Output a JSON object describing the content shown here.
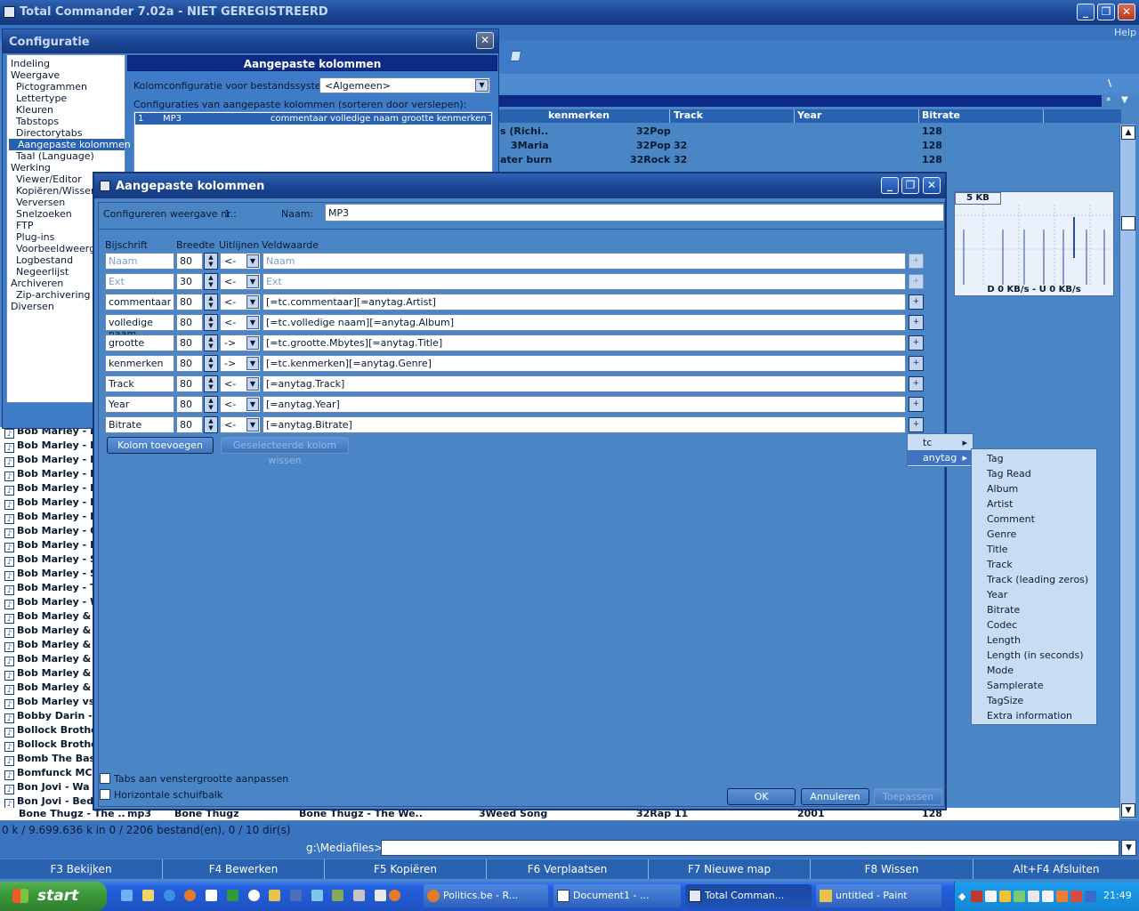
{
  "app": {
    "title": "Total Commander 7.02a - NIET GEREGISTREERD",
    "help": "Help",
    "path_backslash": "\\",
    "path_star": "*",
    "right_columns": [
      "kenmerken",
      "Track",
      "Year",
      "Bitrate"
    ],
    "right_rows": [
      {
        "c1": "s (Richi..",
        "c2": "32Pop",
        "c3": "",
        "c4": "128"
      },
      {
        "c1": "3Maria",
        "c2": "32Pop",
        "c3": "32",
        "c4": "128"
      },
      {
        "c1": "ater burn",
        "c2": "32Rock",
        "c3": "32",
        "c4": "128"
      }
    ],
    "speed_size": "5 KB",
    "speed_text": "D 0 KB/s - U 0 KB/s",
    "left_rows": [
      "Bob Marley - B",
      "Bob Marley - E",
      "Bob Marley - I",
      "Bob Marley - K",
      "Bob Marley - K",
      "Bob Marley - M",
      "Bob Marley - M",
      "Bob Marley - O",
      "Bob Marley - R",
      "Bob Marley - S",
      "Bob Marley - S",
      "Bob Marley - T",
      "Bob Marley - W",
      "Bob Marley & F",
      "Bob Marley & F",
      "Bob Marley & F",
      "Bob Marley & F",
      "Bob Marley & F",
      "Bob Marley & S",
      "Bob Marley vs",
      "Bobby Darin -",
      "Bollock Brothe",
      "Bollock Brothe",
      "Bomb The Bas",
      "Bomfunck MC'",
      "Bon Jovi - Wa",
      "Bon Jovi - Bed"
    ],
    "bottom_row": {
      "name": "Bone Thugz - The ..",
      "ext": "mp3",
      "artist": "Bone Thugz",
      "title": "Bone Thugz - The We..",
      "track": "3Weed Song",
      "genre": "32Rap 11",
      "year": "2001",
      "bitrate": "128"
    },
    "status": "0 k / 9.699.636 k in 0 / 2206 bestand(en), 0 / 10 dir(s)",
    "cmd_path": "g:\\Mediafiles>",
    "fkeys": [
      "F3 Bekijken",
      "F4 Bewerken",
      "F5 Kopiëren",
      "F6 Verplaatsen",
      "F7 Nieuwe map",
      "F8 Wissen",
      "Alt+F4 Afsluiten"
    ]
  },
  "config": {
    "title": "Configuratie",
    "tree": [
      {
        "label": "Indeling",
        "level": 0
      },
      {
        "label": "Weergave",
        "level": 0
      },
      {
        "label": "Pictogrammen",
        "level": 1
      },
      {
        "label": "Lettertype",
        "level": 1
      },
      {
        "label": "Kleuren",
        "level": 1
      },
      {
        "label": "Tabstops",
        "level": 1
      },
      {
        "label": "Directorytabs",
        "level": 1
      },
      {
        "label": "Aangepaste kolommen",
        "level": 1,
        "selected": true
      },
      {
        "label": "Taal (Language)",
        "level": 1
      },
      {
        "label": "Werking",
        "level": 0
      },
      {
        "label": "Viewer/Editor",
        "level": 1
      },
      {
        "label": "Kopiëren/Wissen",
        "level": 1
      },
      {
        "label": "Verversen",
        "level": 1
      },
      {
        "label": "Snelzoeken",
        "level": 1
      },
      {
        "label": "FTP",
        "level": 1
      },
      {
        "label": "Plug-ins",
        "level": 1
      },
      {
        "label": "Voorbeeldweergave",
        "level": 1
      },
      {
        "label": "Logbestand",
        "level": 1
      },
      {
        "label": "Negeerlijst",
        "level": 1
      },
      {
        "label": "Archiveren",
        "level": 0
      },
      {
        "label": "Zip-archivering",
        "level": 1
      },
      {
        "label": "Diversen",
        "level": 0
      }
    ],
    "section_title": "Aangepaste kolommen",
    "fs_label": "Kolomconfiguratie voor bestandssysteem:",
    "fs_value": "<Algemeen>",
    "list_label": "Configuraties van aangepaste kolommen (sorteren door verslepen):",
    "list_item": {
      "num": "1",
      "name": "MP3",
      "cols": "commentaar  volledige naam  grootte  kenmerken  T"
    }
  },
  "dialog": {
    "title": "Aangepaste kolommen",
    "config_label": "Configureren weergave nr.:",
    "config_nr": "1",
    "name_label": "Naam:",
    "name_value": "MP3",
    "headers": {
      "caption": "Bijschrift",
      "width": "Breedte",
      "align": "Uitlijnen",
      "field": "Veldwaarde"
    },
    "rows": [
      {
        "caption": "Naam",
        "width": "80",
        "align": "<-",
        "field": "Naam",
        "disabled": true
      },
      {
        "caption": "Ext",
        "width": "30",
        "align": "<-",
        "field": "Ext",
        "disabled": true
      },
      {
        "caption": "commentaar",
        "width": "80",
        "align": "<-",
        "field": "[=tc.commentaar][=anytag.Artist]"
      },
      {
        "caption": "volledige naam",
        "width": "80",
        "align": "<-",
        "field": "[=tc.volledige naam][=anytag.Album]"
      },
      {
        "caption": "grootte",
        "width": "80",
        "align": "->",
        "field": "[=tc.grootte.Mbytes][=anytag.Title]"
      },
      {
        "caption": "kenmerken",
        "width": "80",
        "align": "->",
        "field": "[=tc.kenmerken][=anytag.Genre]"
      },
      {
        "caption": "Track",
        "width": "80",
        "align": "<-",
        "field": "[=anytag.Track]"
      },
      {
        "caption": "Year",
        "width": "80",
        "align": "<-",
        "field": "[=anytag.Year]"
      },
      {
        "caption": "Bitrate",
        "width": "80",
        "align": "<-",
        "field": "[=anytag.Bitrate]"
      }
    ],
    "add_button": "Kolom toevoegen",
    "delete_button": "Geselecteerde kolom wissen",
    "check_tabs": "Tabs aan venstergrootte aanpassen",
    "check_scroll": "Horizontale schuifbalk",
    "ok": "OK",
    "cancel": "Annuleren",
    "apply": "Toepassen"
  },
  "menu1": [
    "tc",
    "anytag"
  ],
  "menu2": [
    "Tag",
    "Tag Read",
    "Album",
    "Artist",
    "Comment",
    "Genre",
    "Title",
    "Track",
    "Track (leading zeros)",
    "Year",
    "Bitrate",
    "Codec",
    "Length",
    "Length (in seconds)",
    "Mode",
    "Samplerate",
    "TagSize",
    "Extra information"
  ],
  "taskbar": {
    "start": "start",
    "tasks": [
      "Politics.be - R...",
      "Document1 - ...",
      "Total Comman...",
      "untitled - Paint"
    ],
    "clock": "21:49"
  },
  "colors": {
    "accent": "#1a3f91",
    "desktop": "#4a86c6",
    "menu_bg": "#c8dcf4",
    "taskbar": "#245edb",
    "start": "#3c9a3c"
  }
}
